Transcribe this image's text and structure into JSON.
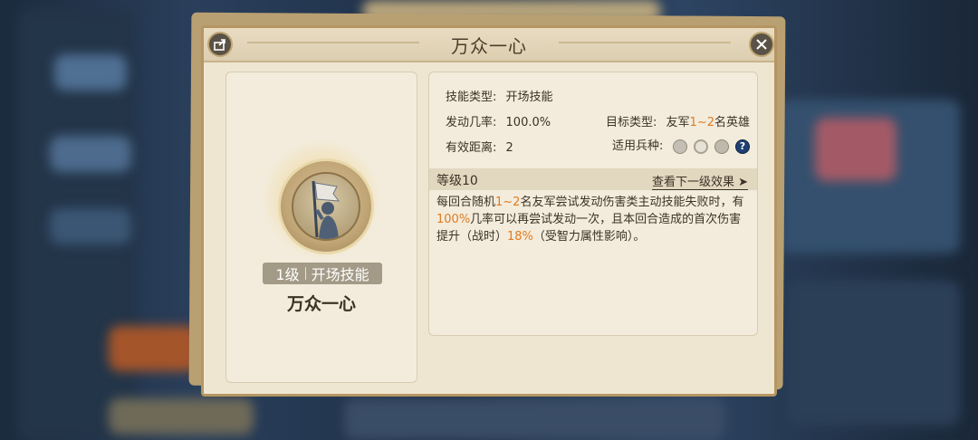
{
  "dialog": {
    "title": "万众一心",
    "share_icon": "share-icon",
    "close_icon": "close-icon"
  },
  "skill_card": {
    "level": "1级",
    "type": "开场技能",
    "name": "万众一心",
    "portrait_icon": "flag-bearer-icon"
  },
  "info": {
    "skill_type_label": "技能类型:",
    "skill_type_value": "开场技能",
    "trigger_rate_label": "发动几率:",
    "trigger_rate_value": "100.0%",
    "target_type_label": "目标类型:",
    "target_type_prefix": "友军",
    "target_type_highlight": "1~2",
    "target_type_suffix": "名英雄",
    "range_label": "有效距离:",
    "range_value": "2",
    "unit_types_label": "适用兵种:",
    "unit_icons": [
      "sword-icon",
      "target-icon",
      "horse-icon",
      "question-icon"
    ],
    "unit_question_mark": "?"
  },
  "level_bar": {
    "level_text": "等级10",
    "next_link": "查看下一级效果 ➤"
  },
  "description": {
    "p1": "每回合随机",
    "h1": "1~2",
    "p2": "名友军尝试发动伤害类主动技能失败时，有",
    "h2": "100%",
    "p3": "几率可以再尝试发动一次，且本回合造成的首次伤害提升（战时）",
    "h3": "18%",
    "p4": "（受智力属性影响）。"
  },
  "colors": {
    "highlight": "#e07b21",
    "panel": "#efe6d2",
    "border": "#b59662"
  }
}
